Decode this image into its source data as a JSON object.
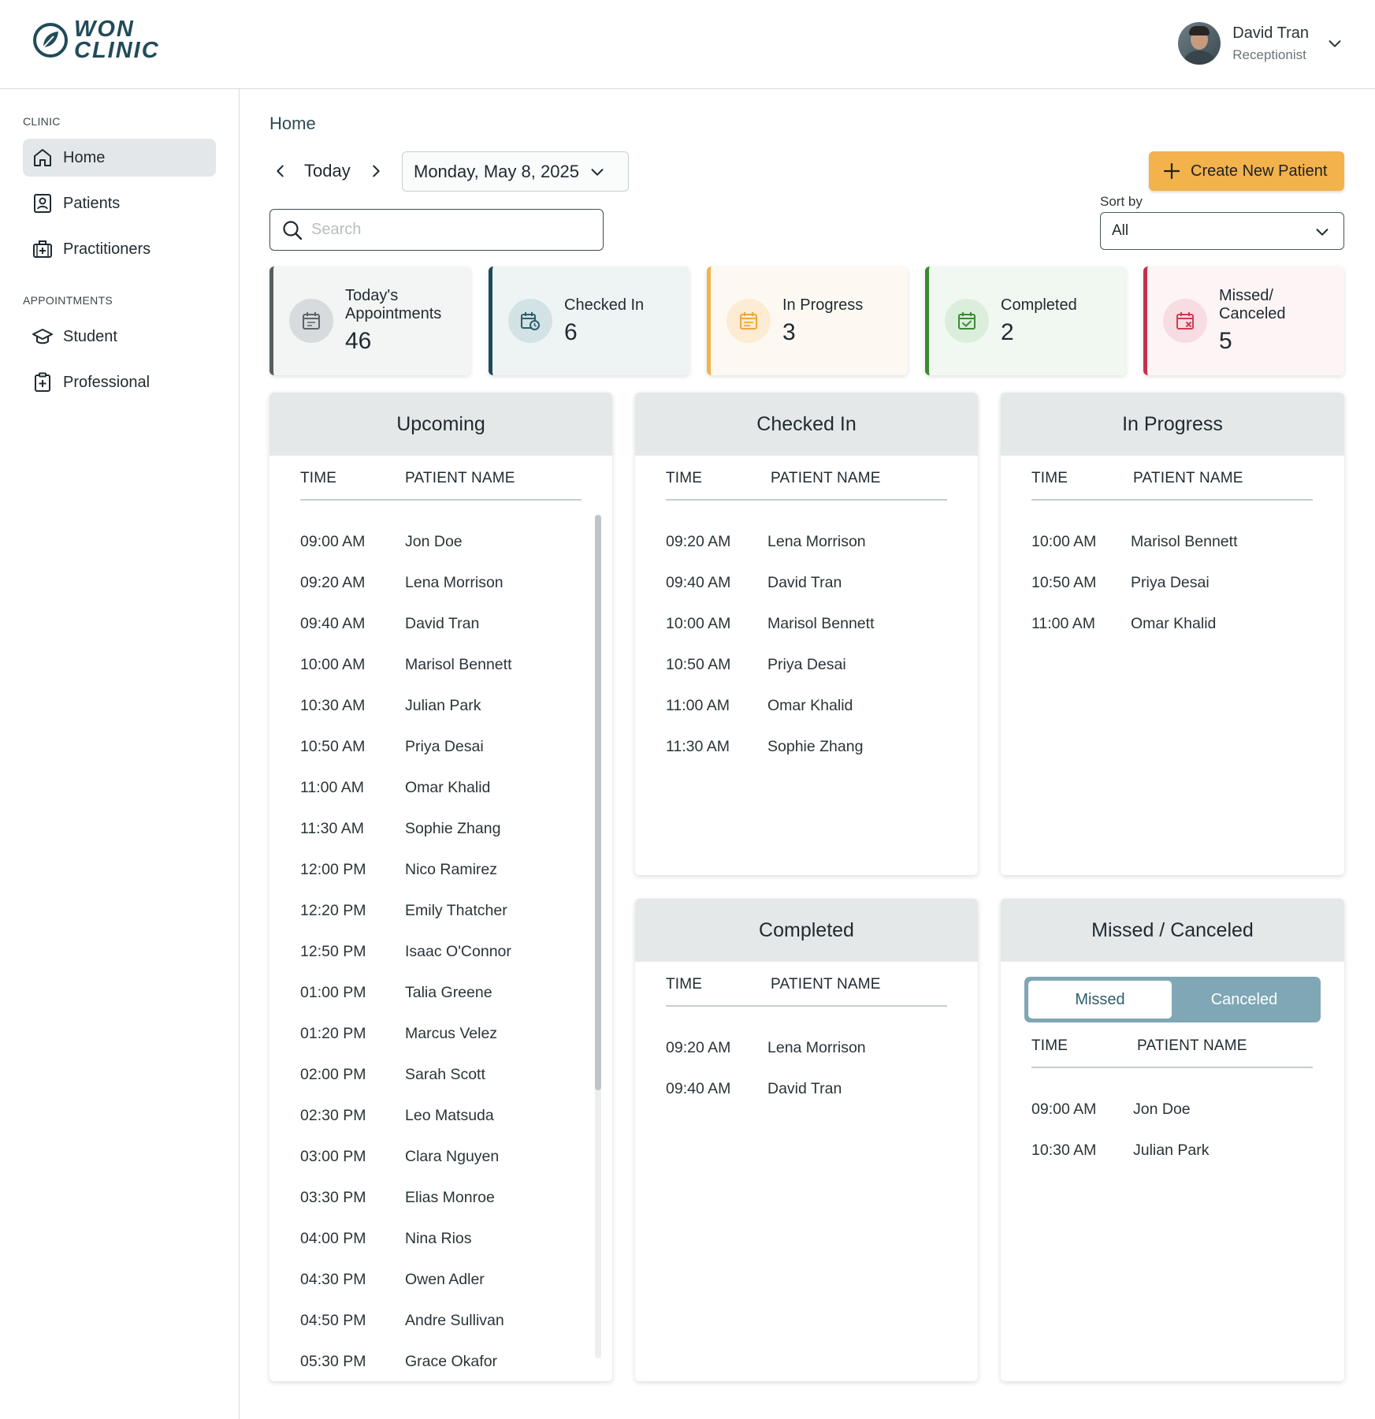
{
  "app": {
    "logo_line1": "WON",
    "logo_line2": "CLINIC"
  },
  "user": {
    "name": "David Tran",
    "role": "Receptionist"
  },
  "sidebar": {
    "clinic_section": "CLINIC",
    "appointments_section": "APPOINTMENTS",
    "items": [
      {
        "label": "Home",
        "icon": "home-icon",
        "active": true
      },
      {
        "label": "Patients",
        "icon": "patient-id-icon"
      },
      {
        "label": "Practitioners",
        "icon": "medical-kit-icon"
      },
      {
        "label": "Student",
        "icon": "graduation-cap-icon"
      },
      {
        "label": "Professional",
        "icon": "clipboard-plus-icon"
      }
    ]
  },
  "main": {
    "breadcrumb": "Home",
    "today_label": "Today",
    "date": "Monday, May 8, 2025",
    "create_button": "Create New Patient",
    "sort_label": "Sort by",
    "sort_value": "All",
    "search_placeholder": "Search"
  },
  "stats": [
    {
      "label_line1": "Today's",
      "label_line2": "Appointments",
      "value": "46",
      "accent": "#555d61",
      "bg": "#f3f4f4",
      "icon_bg": "#d8dbdd",
      "icon_color": "#5b6469"
    },
    {
      "label_line1": "Checked In",
      "label_line2": "",
      "value": "6",
      "accent": "#1f4a5b",
      "bg": "#eef4f4",
      "icon_bg": "#d3e2e4",
      "icon_color": "#2f5e6c"
    },
    {
      "label_line1": "In Progress",
      "label_line2": "",
      "value": "3",
      "accent": "#f2b24c",
      "bg": "#fdf9f2",
      "icon_bg": "#fbecd3",
      "icon_color": "#f0a73a"
    },
    {
      "label_line1": "Completed",
      "label_line2": "",
      "value": "2",
      "accent": "#3a8a2f",
      "bg": "#f1f8f1",
      "icon_bg": "#dbeedb",
      "icon_color": "#3e8a35"
    },
    {
      "label_line1": "Missed/",
      "label_line2": "Canceled",
      "value": "5",
      "accent": "#c92f4a",
      "bg": "#fcf4f5",
      "icon_bg": "#f7dde2",
      "icon_color": "#d23a55"
    }
  ],
  "table_headers": {
    "time": "TIME",
    "patient": "PATIENT NAME"
  },
  "panels": {
    "upcoming": {
      "title": "Upcoming",
      "rows": [
        {
          "time": "09:00 AM",
          "name": "Jon Doe"
        },
        {
          "time": "09:20 AM",
          "name": "Lena Morrison"
        },
        {
          "time": "09:40 AM",
          "name": "David Tran"
        },
        {
          "time": "10:00 AM",
          "name": "Marisol Bennett"
        },
        {
          "time": "10:30 AM",
          "name": "Julian Park"
        },
        {
          "time": "10:50 AM",
          "name": "Priya Desai"
        },
        {
          "time": "11:00 AM",
          "name": "Omar Khalid"
        },
        {
          "time": "11:30 AM",
          "name": "Sophie Zhang"
        },
        {
          "time": "12:00 PM",
          "name": "Nico Ramirez"
        },
        {
          "time": "12:20 PM",
          "name": "Emily Thatcher"
        },
        {
          "time": "12:50 PM",
          "name": "Isaac O'Connor"
        },
        {
          "time": "01:00 PM",
          "name": "Talia Greene"
        },
        {
          "time": "01:20 PM",
          "name": "Marcus Velez"
        },
        {
          "time": "02:00 PM",
          "name": "Sarah Scott"
        },
        {
          "time": "02:30 PM",
          "name": "Leo Matsuda"
        },
        {
          "time": "03:00 PM",
          "name": "Clara Nguyen"
        },
        {
          "time": "03:30 PM",
          "name": "Elias Monroe"
        },
        {
          "time": "04:00 PM",
          "name": "Nina Rios"
        },
        {
          "time": "04:30 PM",
          "name": "Owen Adler"
        },
        {
          "time": "04:50 PM",
          "name": "Andre Sullivan"
        },
        {
          "time": "05:30 PM",
          "name": "Grace Okafor"
        }
      ]
    },
    "checked_in": {
      "title": "Checked In",
      "rows": [
        {
          "time": "09:20 AM",
          "name": "Lena Morrison"
        },
        {
          "time": "09:40 AM",
          "name": "David Tran"
        },
        {
          "time": "10:00 AM",
          "name": "Marisol Bennett"
        },
        {
          "time": "10:50 AM",
          "name": "Priya Desai"
        },
        {
          "time": "11:00 AM",
          "name": "Omar Khalid"
        },
        {
          "time": "11:30 AM",
          "name": "Sophie Zhang"
        }
      ]
    },
    "in_progress": {
      "title": "In Progress",
      "rows": [
        {
          "time": "10:00 AM",
          "name": "Marisol Bennett"
        },
        {
          "time": "10:50 AM",
          "name": "Priya Desai"
        },
        {
          "time": "11:00 AM",
          "name": "Omar Khalid"
        }
      ]
    },
    "completed": {
      "title": "Completed",
      "rows": [
        {
          "time": "09:20 AM",
          "name": "Lena Morrison"
        },
        {
          "time": "09:40 AM",
          "name": "David Tran"
        }
      ]
    },
    "missed": {
      "title": "Missed / Canceled",
      "toggle_missed": "Missed",
      "toggle_canceled": "Canceled",
      "rows": [
        {
          "time": "09:00 AM",
          "name": "Jon Doe"
        },
        {
          "time": "10:30 AM",
          "name": "Julian Park"
        }
      ]
    }
  }
}
